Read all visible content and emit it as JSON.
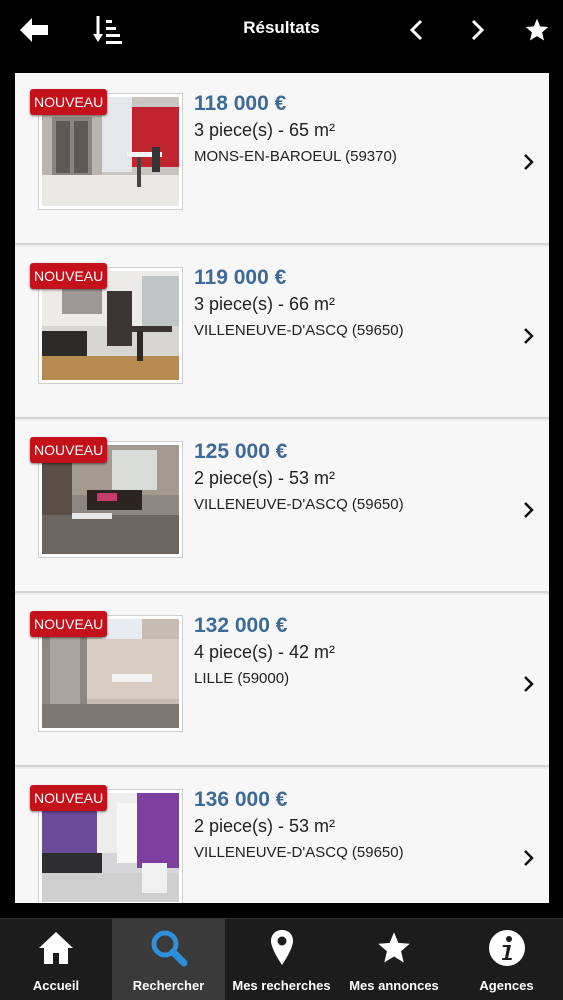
{
  "header": {
    "title": "Résultats"
  },
  "listings": [
    {
      "badge": "NOUVEAU",
      "price": "118 000 €",
      "rooms": "3 piece(s) - 65 m²",
      "city": "MONS-EN-BAROEUL (59370)"
    },
    {
      "badge": "NOUVEAU",
      "price": "119 000 €",
      "rooms": "3 piece(s) - 66 m²",
      "city": "VILLENEUVE-D'ASCQ (59650)"
    },
    {
      "badge": "NOUVEAU",
      "price": "125 000 €",
      "rooms": "2 piece(s) - 53 m²",
      "city": "VILLENEUVE-D'ASCQ (59650)"
    },
    {
      "badge": "NOUVEAU",
      "price": "132 000 €",
      "rooms": "4 piece(s) - 42 m²",
      "city": "LILLE (59000)"
    },
    {
      "badge": "NOUVEAU",
      "price": "136 000 €",
      "rooms": "2 piece(s) - 53 m²",
      "city": "VILLENEUVE-D'ASCQ (59650)"
    }
  ],
  "tabs": [
    {
      "label": "Accueil",
      "icon": "home-icon"
    },
    {
      "label": "Rechercher",
      "icon": "search-icon",
      "active": true
    },
    {
      "label": "Mes recherches",
      "icon": "map-pin-icon"
    },
    {
      "label": "Mes annonces",
      "icon": "star-icon"
    },
    {
      "label": "Agences",
      "icon": "info-icon"
    }
  ],
  "colors": {
    "accent_price": "#3d6a99",
    "badge_red": "#c4111c",
    "search_blue": "#2f8fd8"
  }
}
